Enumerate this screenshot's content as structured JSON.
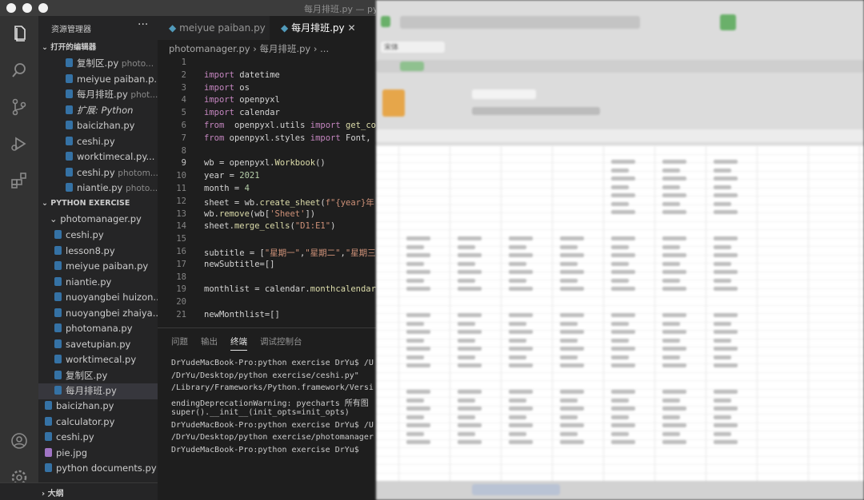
{
  "window": {
    "title": "每月排班.py — pyt"
  },
  "sidebar": {
    "header": "资源管理器",
    "more": "···",
    "open_editors": {
      "label": "打开的编辑器",
      "items": [
        {
          "name": "复制区.py",
          "path": "photo..."
        },
        {
          "name": "meiyue paiban.p...",
          "path": ""
        },
        {
          "name": "每月排班.py",
          "path": "phot..."
        },
        {
          "name": "扩展: Python",
          "path": ""
        },
        {
          "name": "baicizhan.py",
          "path": ""
        },
        {
          "name": "ceshi.py",
          "path": ""
        },
        {
          "name": "worktimecal.py...",
          "path": ""
        },
        {
          "name": "ceshi.py",
          "path": "photom..."
        },
        {
          "name": "niantie.py",
          "path": "photo..."
        }
      ]
    },
    "workspace": {
      "label": "PYTHON EXERCISE",
      "folder": "photomanager.py",
      "folder_items": [
        "ceshi.py",
        "lesson8.py",
        "meiyue paiban.py",
        "niantie.py",
        "nuoyangbei huizon...",
        "nuoyangbei zhaiya...",
        "photomana.py",
        "savetupian.py",
        "worktimecal.py",
        "复制区.py",
        "每月排班.py"
      ],
      "root_items": [
        "baicizhan.py",
        "calculator.py",
        "ceshi.py",
        "pie.jpg",
        "python documents.py"
      ]
    },
    "outline": "大纲"
  },
  "editor": {
    "tabs": [
      "meiyue paiban.py",
      "每月排班.py"
    ],
    "breadcrumb": "photomanager.py  ›  每月排班.py  › ...",
    "lines": [
      {
        "n": "1",
        "html": ""
      },
      {
        "n": "2",
        "html": "<span class='kw'>import</span> datetime"
      },
      {
        "n": "3",
        "html": "<span class='kw'>import</span> os"
      },
      {
        "n": "4",
        "html": "<span class='kw'>import</span> openpyxl"
      },
      {
        "n": "5",
        "html": "<span class='kw'>import</span> calendar"
      },
      {
        "n": "6",
        "html": "<span class='kw'>from</span>  openpyxl.utils <span class='kw'>import</span> <span class='fn'>get_co</span>"
      },
      {
        "n": "7",
        "html": "<span class='kw'>from</span> openpyxl.styles <span class='kw'>import</span> Font,"
      },
      {
        "n": "8",
        "html": ""
      },
      {
        "n": "9",
        "html": "wb = openpyxl.<span class='fn'>Workbook</span>()"
      },
      {
        "n": "10",
        "html": "year = <span class='nm'>2021</span>"
      },
      {
        "n": "11",
        "html": "month = <span class='nm'>4</span>"
      },
      {
        "n": "12",
        "html": "sheet = wb.<span class='fn'>create_sheet</span>(<span class='st'>f\"{year}年</span>"
      },
      {
        "n": "13",
        "html": "wb.<span class='fn'>remove</span>(wb[<span class='st'>'Sheet'</span>])"
      },
      {
        "n": "14",
        "html": "sheet.<span class='fn'>merge_cells</span>(<span class='st'>\"D1:E1\"</span>)"
      },
      {
        "n": "15",
        "html": ""
      },
      {
        "n": "16",
        "html": "subtitle = [<span class='st'>\"星期一\"</span>,<span class='st'>\"星期二\"</span>,<span class='st'>\"星期三</span>"
      },
      {
        "n": "17",
        "html": "newSubtitle=[]"
      },
      {
        "n": "18",
        "html": ""
      },
      {
        "n": "19",
        "html": "monthlist = calendar.<span class='fn'>monthcalendar</span>"
      },
      {
        "n": "20",
        "html": ""
      },
      {
        "n": "21",
        "html": "newMonthlist=[]"
      }
    ]
  },
  "panel": {
    "tabs": [
      "问题",
      "输出",
      "终端",
      "调试控制台"
    ],
    "active": "终端",
    "terminal": [
      "DrYudeMacBook-Pro:python exercise DrYu$ /U",
      "/DrYu/Desktop/python exercise/ceshi.py\"",
      "/Library/Frameworks/Python.framework/Versi",
      "endingDeprecationWarning: pyecharts 所有图",
      "  super().__init__(init_opts=init_opts)",
      "DrYudeMacBook-Pro:python exercise DrYu$ /U",
      "/DrYu/Desktop/python exercise/photomanager",
      "DrYudeMacBook-Pro:python exercise DrYu$ "
    ]
  },
  "excel": {
    "font_name": "宋体"
  }
}
